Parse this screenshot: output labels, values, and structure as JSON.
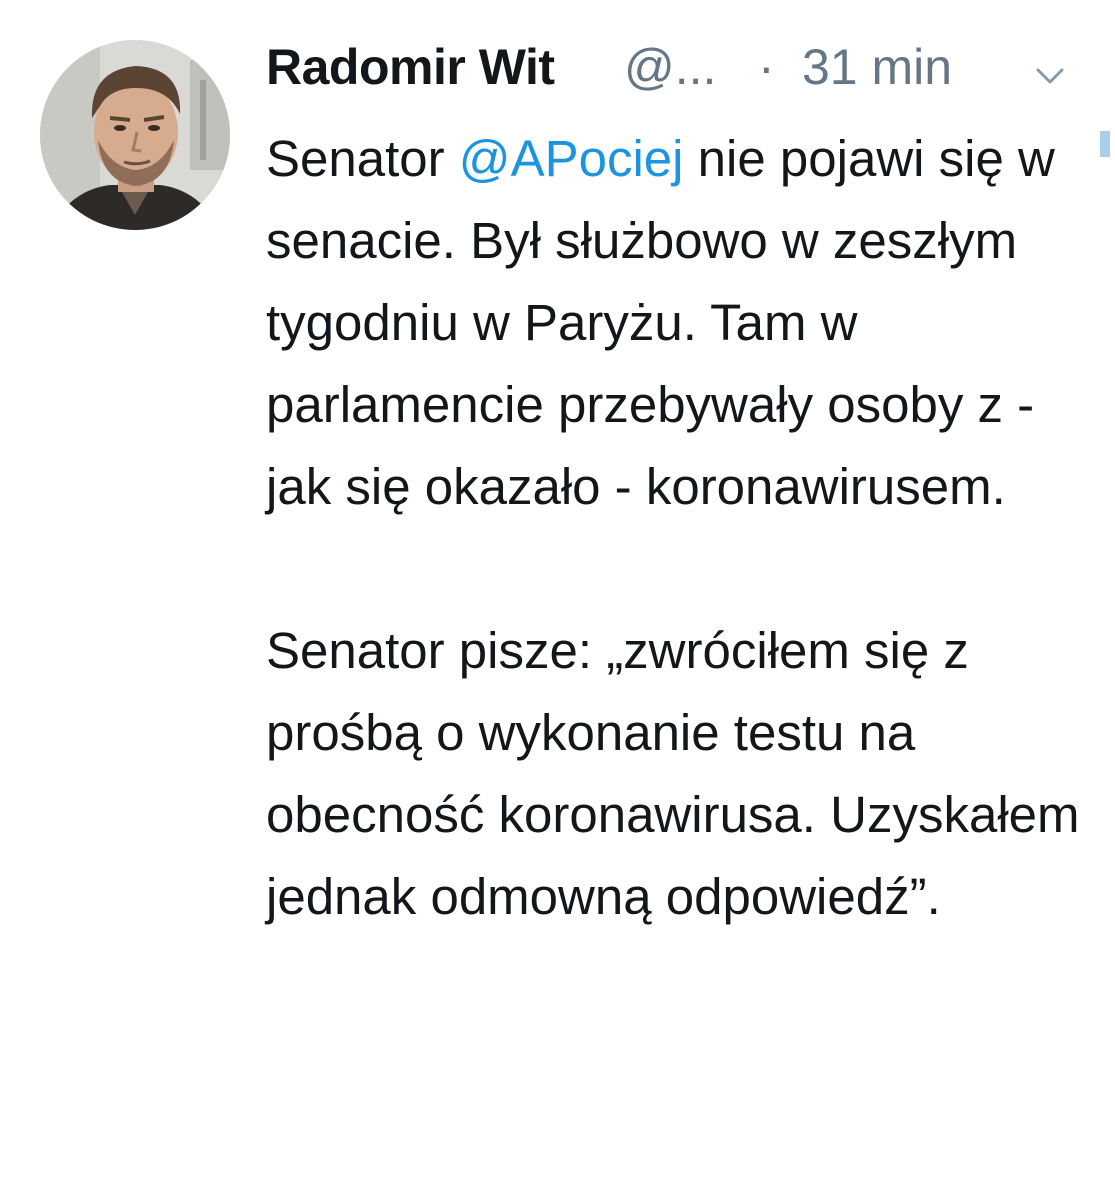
{
  "tweet": {
    "author": {
      "name": "Radomir Wit",
      "handle": "@...",
      "avatar_icon": "profile-photo"
    },
    "separator": "·",
    "time": "31 min",
    "menu_icon": "chevron-down-icon",
    "paragraph1": {
      "prefix": "Senator ",
      "mention": "@APociej",
      "suffix": " nie pojawi się w senacie. Był służbowo w zeszłym tygodniu w Paryżu. Tam w parlamencie przebywały osoby z - jak się okazało - koronawirusem."
    },
    "paragraph2": "Senator pisze: „zwróciłem się z prośbą o wykonanie testu na obecność koronawirusa. Uzyskałem jednak odmowną odpowiedź”."
  },
  "colors": {
    "text": "#14171a",
    "secondary": "#657786",
    "link": "#1b95e0"
  }
}
